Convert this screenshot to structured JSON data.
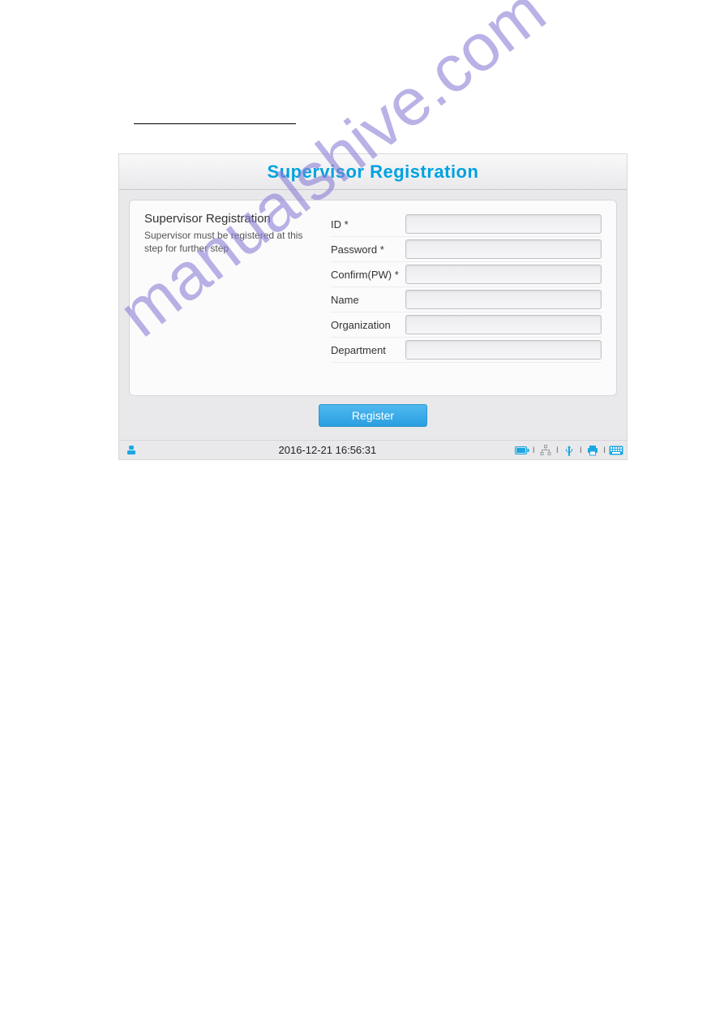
{
  "header": {
    "title": "Supervisor Registration"
  },
  "panel": {
    "heading": "Supervisor Registration",
    "note": "Supervisor must be registered at this step for further step"
  },
  "form": {
    "fields": [
      {
        "label": "ID *",
        "value": ""
      },
      {
        "label": "Password *",
        "value": ""
      },
      {
        "label": "Confirm(PW) *",
        "value": ""
      },
      {
        "label": "Name",
        "value": ""
      },
      {
        "label": "Organization",
        "value": ""
      },
      {
        "label": "Department",
        "value": ""
      }
    ]
  },
  "buttons": {
    "register": "Register"
  },
  "statusbar": {
    "datetime": "2016-12-21 16:56:31"
  },
  "watermark": "manualshive.com"
}
